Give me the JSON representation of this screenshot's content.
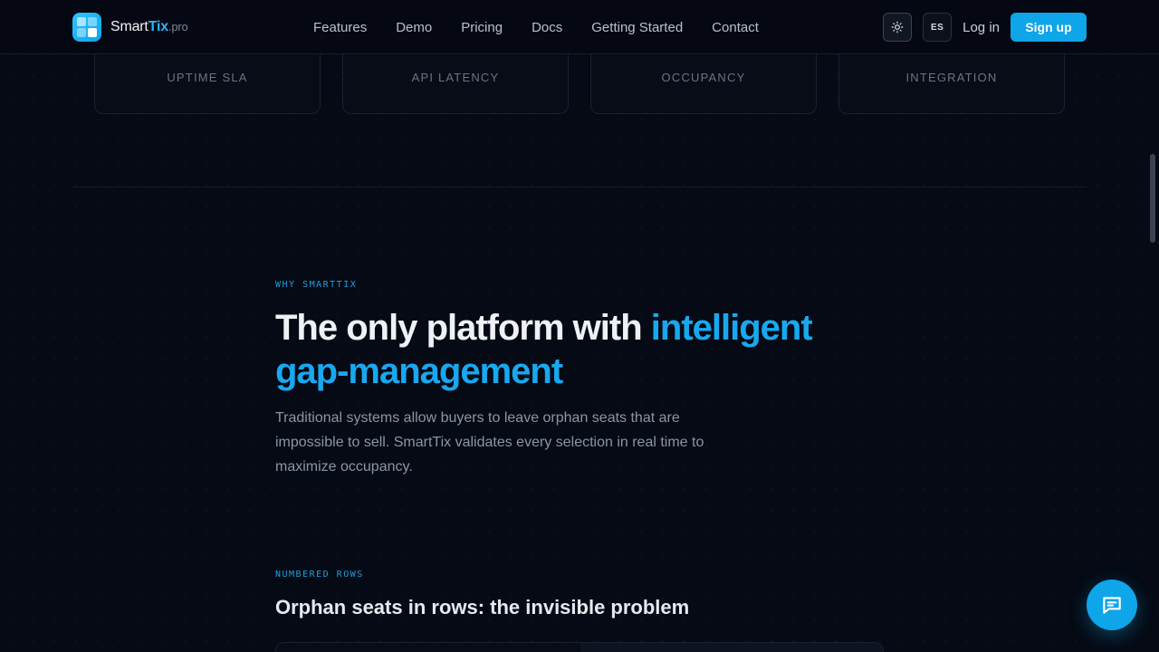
{
  "brand": {
    "name": "Smart",
    "highlight": "Tix",
    "suffix": ".pro"
  },
  "nav": {
    "items": [
      {
        "label": "Features"
      },
      {
        "label": "Demo"
      },
      {
        "label": "Pricing"
      },
      {
        "label": "Docs"
      },
      {
        "label": "Getting Started"
      },
      {
        "label": "Contact"
      }
    ]
  },
  "actions": {
    "theme_icon": "sun-icon",
    "language": "ES",
    "login": "Log in",
    "signup": "Sign up"
  },
  "stats": [
    {
      "label": "UPTIME SLA"
    },
    {
      "label": "API LATENCY"
    },
    {
      "label": "OCCUPANCY"
    },
    {
      "label": "INTEGRATION"
    }
  ],
  "why": {
    "eyebrow": "WHY SMARTTIX",
    "headline_plain": "The only platform with ",
    "headline_accent_1": "intelligent",
    "headline_accent_2": "gap-management",
    "lead": "Traditional systems allow buyers to leave orphan seats that are impossible to sell. SmartTix validates every selection in real time to maximize occupancy."
  },
  "rows": {
    "eyebrow": "NUMBERED ROWS",
    "title": "Orphan seats in rows: the invisible problem"
  },
  "chat": {
    "icon": "chat-bubble-icon"
  },
  "colors": {
    "accent": "#0ea5e9",
    "background": "#050a14"
  }
}
